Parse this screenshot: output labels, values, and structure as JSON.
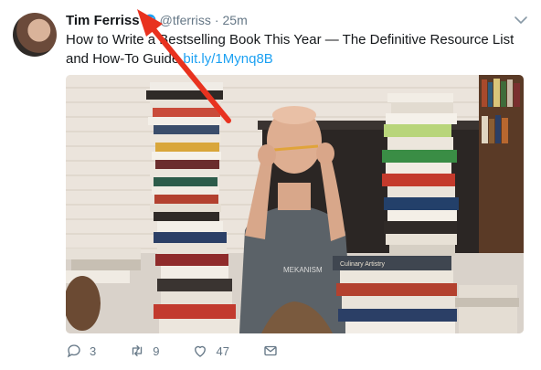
{
  "author": {
    "name": "Tim Ferriss",
    "handle": "@tferriss",
    "separator": "·",
    "time": "25m",
    "verified": true
  },
  "tweet": {
    "text_line": "How to Write a Bestselling Book This Year — The Definitive Resource List and How-To Guide ",
    "link_text": "bit.ly/1Mynq8B"
  },
  "actions": {
    "reply_count": "3",
    "retweet_count": "9",
    "like_count": "47"
  },
  "colors": {
    "accent": "#1da1f2",
    "muted": "#657786",
    "annotation": "#e8321f"
  },
  "icons": [
    "verified-badge-icon",
    "chevron-down-icon",
    "reply-icon",
    "retweet-icon",
    "like-icon",
    "message-icon"
  ]
}
